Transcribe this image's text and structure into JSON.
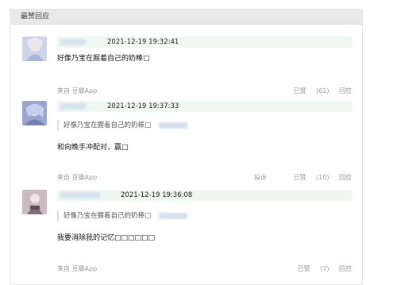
{
  "section": {
    "title": "最赞回应"
  },
  "comments": [
    {
      "time": "2021-12-19 19:32:41",
      "content": "好像乃宝在握着自己的奶棒□",
      "source_prefix": "来自",
      "source_app": "豆瓣App",
      "like_label": "已赞",
      "like_count": "(61)",
      "reply_label": "回应"
    },
    {
      "time": "2021-12-19 19:37:33",
      "quote": "好像乃宝在握着自己的奶棒□",
      "content": "和向晚手冲配对，赢□",
      "source_prefix": "来自",
      "source_app": "豆瓣App",
      "report_label": "投诉",
      "like_label": "已赞",
      "like_count": "(10)",
      "reply_label": "回应"
    },
    {
      "time": "2021-12-19 19:36:08",
      "quote": "好像乃宝在握着自己的奶棒□",
      "content": "我要消除我的记忆□□□□□□",
      "source_prefix": "来自",
      "source_app": "豆瓣App",
      "like_label": "已赞",
      "like_count": "(7)",
      "reply_label": "回应"
    }
  ]
}
